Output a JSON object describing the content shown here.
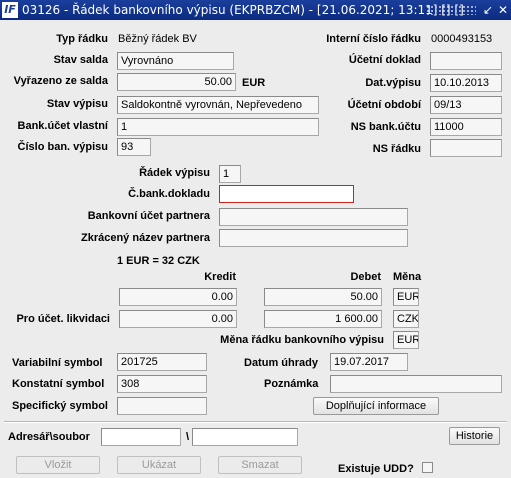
{
  "window": {
    "title": "03126 - Řádek bankovního výpisu (EKPRBZCM) - [21.06.2021; 13:11] [] []",
    "app_icon": "IF",
    "minimize_glyph": "↙",
    "close_glyph": "✕"
  },
  "header": {
    "typ_radku_label": "Typ řádku",
    "typ_radku_value": "Běžný řádek BV",
    "interni_cislo_label": "Interní číslo řádku",
    "interni_cislo_value": "0000493153",
    "stav_salda_label": "Stav salda",
    "stav_salda_value": "Vyrovnáno",
    "ucetni_doklad_label": "Účetní doklad",
    "ucetni_doklad_value": "",
    "vyrazeno_label": "Vyřazeno ze salda",
    "vyrazeno_value": "50.00",
    "vyrazeno_currency": "EUR",
    "dat_vypisu_label": "Dat.výpisu",
    "dat_vypisu_value": "10.10.2013",
    "stav_vypisu_label": "Stav výpisu",
    "stav_vypisu_value": "Saldokontně vyrovnán, Nepřevedeno",
    "ucetni_obdobi_label": "Účetní období",
    "ucetni_obdobi_value": "09/13",
    "bank_ucet_label": "Bank.účet vlastní",
    "bank_ucet_value": "1",
    "ns_bank_uctu_label": "NS bank.účtu",
    "ns_bank_uctu_value": "11000",
    "cislo_vypisu_label": "Číslo ban. výpisu",
    "cislo_vypisu_value": "93",
    "ns_radku_label": "NS řádku",
    "ns_radku_value": ""
  },
  "middle": {
    "radek_vypisu_label": "Řádek výpisu",
    "radek_vypisu_value": "1",
    "c_bank_dokladu_label": "Č.bank.dokladu",
    "c_bank_dokladu_value": "",
    "ucet_partnera_label": "Bankovní účet partnera",
    "ucet_partnera_value": "",
    "nazev_partnera_label": "Zkrácený název partnera",
    "nazev_partnera_value": ""
  },
  "amounts": {
    "rate_text": "1 EUR = 32 CZK",
    "kredit_label": "Kredit",
    "debet_label": "Debet",
    "mena_label": "Měna",
    "row1_kredit": "0.00",
    "row1_debet": "50.00",
    "row1_mena": "EUR",
    "pro_ucet_label": "Pro účet. likvidaci",
    "row2_kredit": "0.00",
    "row2_debet": "1 600.00",
    "row2_mena": "CZK",
    "mena_radku_label": "Měna řádku bankovního výpisu",
    "mena_radku_value": "EUR"
  },
  "symbols": {
    "variabilni_label": "Variabilní symbol",
    "variabilni_value": "201725",
    "datum_uhrady_label": "Datum úhrady",
    "datum_uhrady_value": "19.07.2017",
    "konstantni_label": "Konstatní symbol",
    "konstantni_value": "308",
    "poznamka_label": "Poznámka",
    "poznamka_value": "",
    "specificky_label": "Specifický symbol",
    "specificky_value": "",
    "doplnujici_button": "Doplňující informace"
  },
  "bottom": {
    "adresar_label": "Adresář\\soubor",
    "adresar_value": "",
    "backslash": "\\",
    "soubor_value": "",
    "historie_button": "Historie",
    "vlozit_button": "Vložit",
    "ukazat_button": "Ukázat",
    "smazat_button": "Smazat",
    "existuje_udd_label": "Existuje UDD?"
  }
}
